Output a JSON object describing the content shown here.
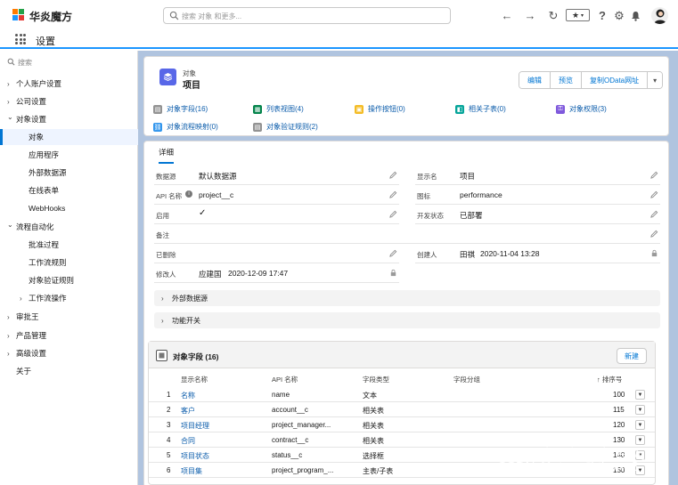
{
  "header": {
    "brand": "华炎魔方",
    "search_placeholder": "搜索 对象 和更多...",
    "colors": {
      "accent": "#0176d3",
      "brand_green": "#24a148",
      "brand_orange": "#ff7a00",
      "brand_blue": "#1b96ff",
      "brand_red": "#e53935"
    }
  },
  "app": {
    "title": "设置"
  },
  "sidebar": {
    "quickfind_placeholder": "搜索",
    "items": [
      {
        "label": "个人账户设置",
        "chevron": "›"
      },
      {
        "label": "公司设置",
        "chevron": "›"
      },
      {
        "label": "对象设置",
        "chevron": "⌄"
      },
      {
        "label": "对象",
        "chevron": ""
      },
      {
        "label": "应用程序",
        "chevron": ""
      },
      {
        "label": "外部数据源",
        "chevron": ""
      },
      {
        "label": "在线表单",
        "chevron": ""
      },
      {
        "label": "WebHooks",
        "chevron": ""
      },
      {
        "label": "流程自动化",
        "chevron": "⌄"
      },
      {
        "label": "批准过程",
        "chevron": ""
      },
      {
        "label": "工作流规则",
        "chevron": ""
      },
      {
        "label": "对象验证规则",
        "chevron": ""
      },
      {
        "label": "工作流操作",
        "chevron": "›"
      },
      {
        "label": "审批王",
        "chevron": "›"
      },
      {
        "label": "产品管理",
        "chevron": "›"
      },
      {
        "label": "高级设置",
        "chevron": "›"
      },
      {
        "label": "关于",
        "chevron": ""
      }
    ]
  },
  "object_header": {
    "kicker": "对象",
    "title": "项目",
    "buttons": [
      "编辑",
      "预览",
      "复制OData网址",
      "▾"
    ]
  },
  "quick_links": [
    {
      "label": "对象字段(16)",
      "color": "#939393"
    },
    {
      "label": "列表视图(4)",
      "color": "#04844b"
    },
    {
      "label": "操作按钮(0)",
      "color": "#f4bc25"
    },
    {
      "label": "相关子表(0)",
      "color": "#06a59a"
    },
    {
      "label": "对象权限(3)",
      "color": "#7f59dc"
    },
    {
      "label": "对象流程映射(0)",
      "color": "#3296ed"
    },
    {
      "label": "对象验证规则(2)",
      "color": "#939393"
    }
  ],
  "detail": {
    "tab": "详细",
    "left": [
      {
        "label": "数据源",
        "value": "默认数据源"
      },
      {
        "label": "API 名称",
        "value": "project__c"
      },
      {
        "label": "启用",
        "value": "✓"
      },
      {
        "label": "备注",
        "value": ""
      },
      {
        "label": "已删除",
        "value": ""
      },
      {
        "label": "修改人",
        "value": "应建国",
        "date": "2020-12-09 17:47"
      }
    ],
    "right": [
      {
        "label": "显示名",
        "value": "项目"
      },
      {
        "label": "图标",
        "value": "performance"
      },
      {
        "label": "开发状态",
        "value": "已部署"
      },
      {
        "label": "创建人",
        "value": "田祺",
        "date": "2020-11-04 13:28"
      }
    ],
    "sections": [
      "外部数据源",
      "功能开关"
    ]
  },
  "related": {
    "title": "对象字段 (16)",
    "new_button": "新建",
    "columns": [
      "显示名称",
      "API 名称",
      "字段类型",
      "字段分组",
      "↑ 排序号"
    ],
    "rows": [
      {
        "num": "1",
        "name": "名称",
        "api": "name",
        "type": "文本",
        "group": "",
        "order": "100"
      },
      {
        "num": "2",
        "name": "客户",
        "api": "account__c",
        "type": "相关表",
        "group": "",
        "order": "115"
      },
      {
        "num": "3",
        "name": "项目经理",
        "api": "project_manager...",
        "type": "相关表",
        "group": "",
        "order": "120"
      },
      {
        "num": "4",
        "name": "合同",
        "api": "contract__c",
        "type": "相关表",
        "group": "",
        "order": "130"
      },
      {
        "num": "5",
        "name": "项目状态",
        "api": "status__c",
        "type": "选择框",
        "group": "",
        "order": "140"
      },
      {
        "num": "6",
        "name": "项目集",
        "api": "project_program_...",
        "type": "主表/子表",
        "group": "",
        "order": "150"
      }
    ]
  },
  "watermark": {
    "line1": "知乎 @老罗入",
    "line2": "CSDN @xiangzhihong8"
  }
}
